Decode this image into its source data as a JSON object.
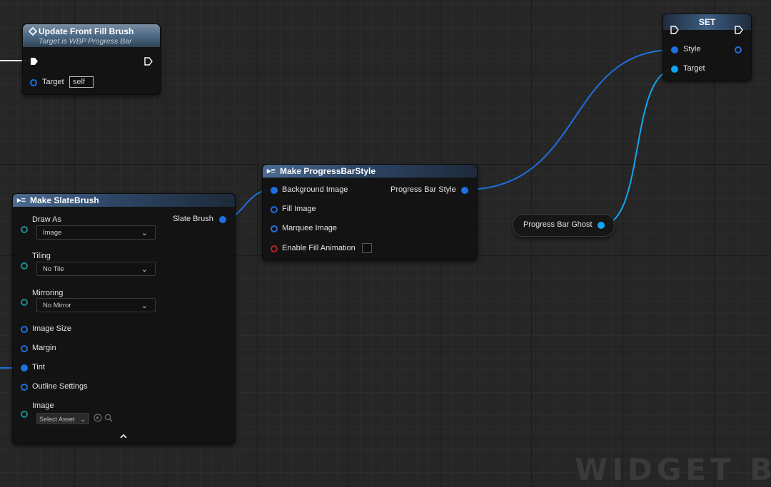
{
  "nodes": {
    "update_front_fill_brush": {
      "title": "Update Front Fill Brush",
      "subtitle": "Target is WBP Progress Bar",
      "target_label": "Target",
      "target_value": "self"
    },
    "set": {
      "title": "SET",
      "style_label": "Style",
      "target_label": "Target"
    },
    "make_progress_bar_style": {
      "title": "Make ProgressBarStyle",
      "inputs": [
        "Background Image",
        "Fill Image",
        "Marquee Image",
        "Enable Fill Animation"
      ],
      "output": "Progress Bar Style"
    },
    "make_slate_brush": {
      "title": "Make SlateBrush",
      "output": "Slate Brush",
      "draw_as_label": "Draw As",
      "draw_as_value": "Image",
      "tiling_label": "Tiling",
      "tiling_value": "No Tile",
      "mirroring_label": "Mirroring",
      "mirroring_value": "No Mirror",
      "image_size_label": "Image Size",
      "margin_label": "Margin",
      "tint_label": "Tint",
      "outline_settings_label": "Outline Settings",
      "image_label": "Image",
      "image_value": "Select Asset"
    },
    "progress_bar_ghost": {
      "label": "Progress Bar Ghost"
    }
  },
  "colors": {
    "grid_bg": "#262626",
    "struct_pin": "#1e70e0",
    "object_pin": "#12a6f0",
    "byte_pin": "#1b8c8e",
    "bool_pin": "#b22222",
    "exec_pin": "#ffffff"
  },
  "watermark": "WIDGET BL"
}
